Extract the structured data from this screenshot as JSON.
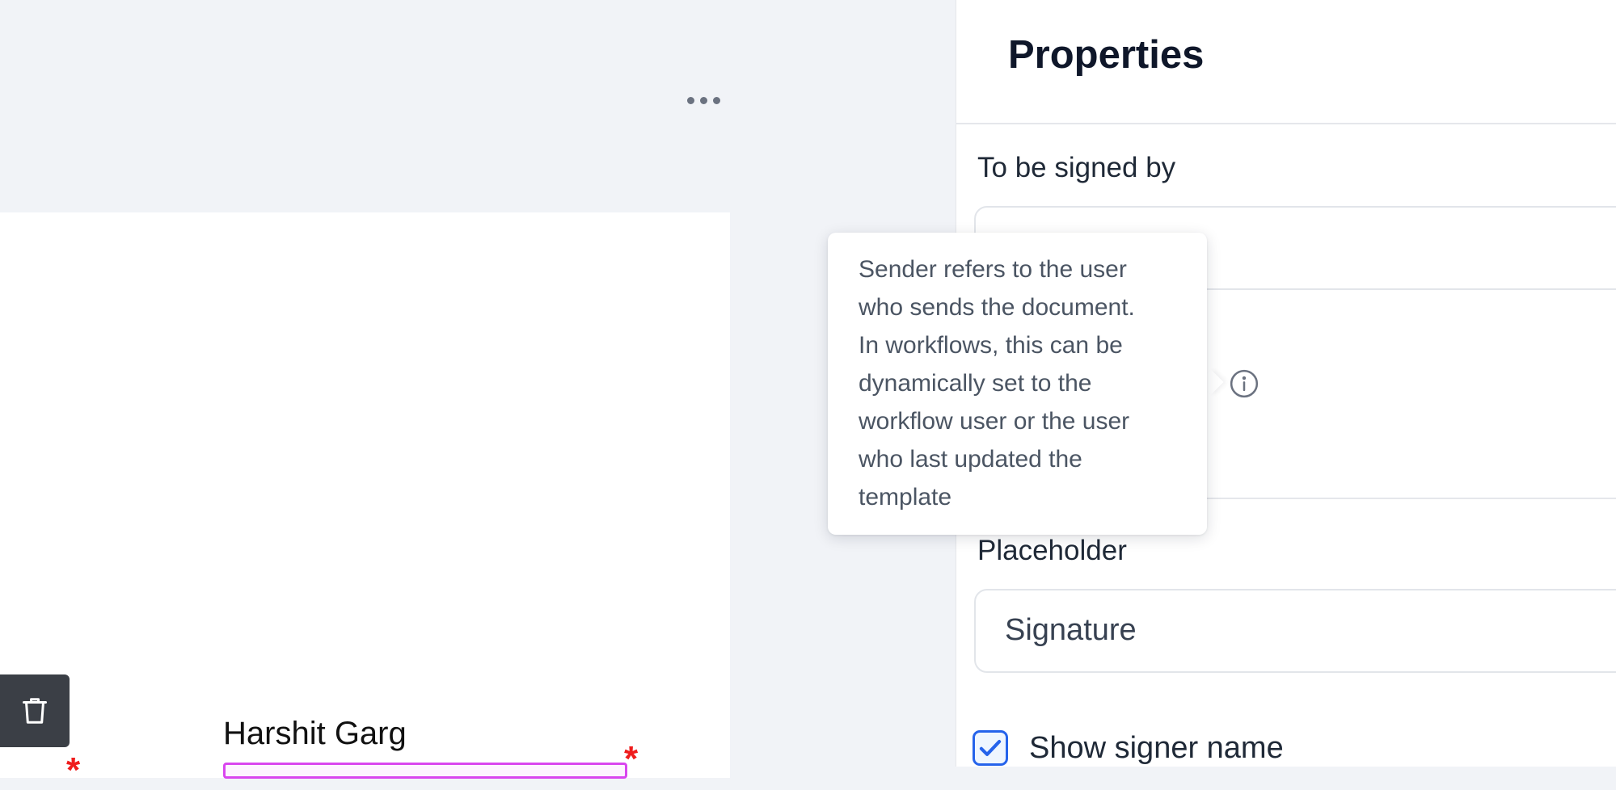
{
  "canvas": {
    "more_label": "More options",
    "signer_name": "Harshit Garg",
    "required_mark": "*",
    "delete_label": "Delete"
  },
  "properties": {
    "title": "Properties",
    "signed_by_label": "To be signed by",
    "placeholder_label": "Placeholder",
    "placeholder_value": "Signature",
    "show_signer_name_label": "Show signer name",
    "show_signer_name_checked": true
  },
  "tooltip": {
    "lines": [
      "Sender refers to the user",
      "who sends the document.",
      "In workflows, this can be",
      "dynamically set to the",
      "workflow user or the user",
      "who last updated the",
      "template"
    ]
  },
  "colors": {
    "accent": "#2563eb",
    "required": "#ef1c1c",
    "signature_box": "#d946ef"
  },
  "icons": {
    "more": "ellipsis-icon",
    "delete": "trash-icon",
    "info": "info-icon",
    "check": "check-icon"
  }
}
